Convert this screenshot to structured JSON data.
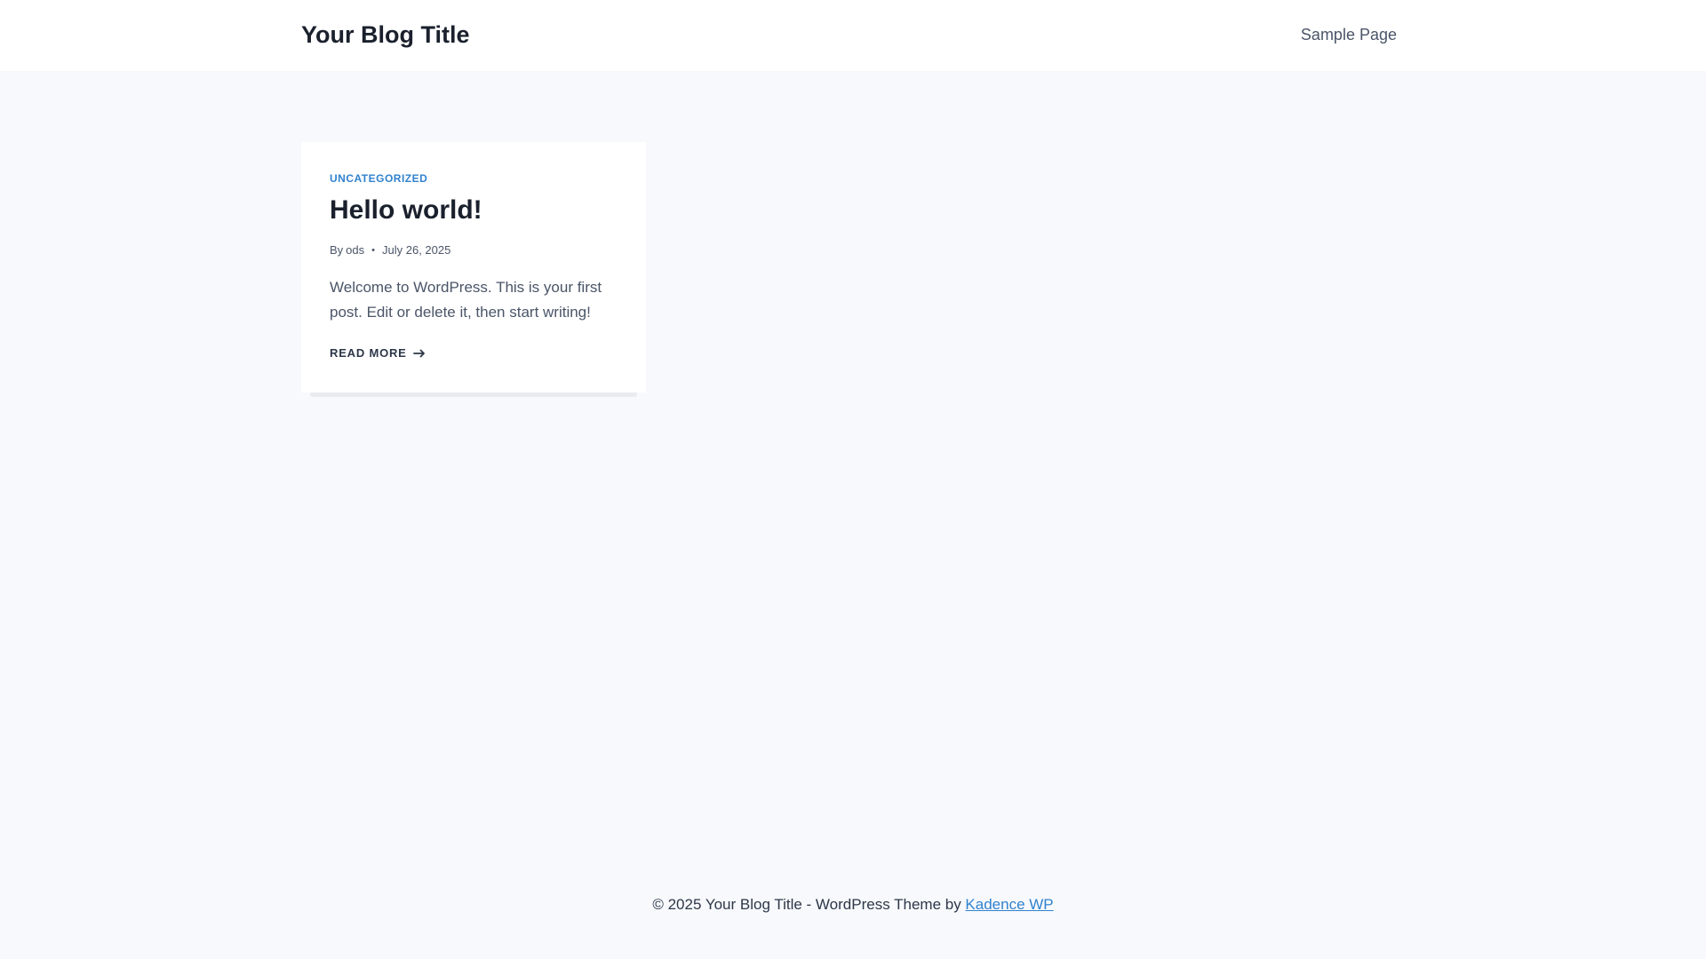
{
  "header": {
    "site_title": "Your Blog Title",
    "nav": [
      {
        "label": "Sample Page"
      }
    ]
  },
  "post": {
    "category": "UNCATEGORIZED",
    "title": "Hello world!",
    "by_label": "By",
    "author": "ods",
    "separator": "•",
    "date": "July 26, 2025",
    "excerpt": "Welcome to WordPress. This is your first post. Edit or delete it, then start writing!",
    "read_more": "READ MORE",
    "read_more_icon": "arrow-right-icon"
  },
  "footer": {
    "text": "© 2025 Your Blog Title - WordPress Theme by",
    "link_label": "Kadence WP"
  },
  "colors": {
    "page_bg": "#f7f9fc",
    "accent": "#3182ce",
    "heading": "#1a202c",
    "text": "#4a5568"
  }
}
